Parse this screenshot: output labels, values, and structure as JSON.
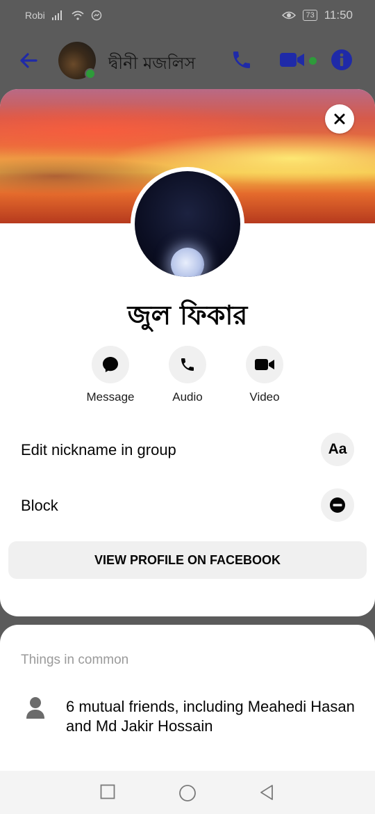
{
  "status_bar": {
    "carrier": "Robi",
    "battery": "73",
    "time": "11:50"
  },
  "header": {
    "title": "দ্বীনী মজলিস"
  },
  "profile": {
    "name": "জুল ফিকার"
  },
  "actions": [
    {
      "label": "Message",
      "icon": "message-bubble-icon"
    },
    {
      "label": "Audio",
      "icon": "phone-icon"
    },
    {
      "label": "Video",
      "icon": "video-camera-icon"
    }
  ],
  "options": {
    "edit_nickname": {
      "label": "Edit nickname in group",
      "icon_text": "Aa"
    },
    "block": {
      "label": "Block"
    }
  },
  "view_profile_label": "VIEW PROFILE ON FACEBOOK",
  "common": {
    "title": "Things in common",
    "mutual_friends": "6 mutual friends, including Meahedi Hasan and Md Jakir Hossain"
  },
  "colors": {
    "accent": "#1f2aa8",
    "online": "#2e9b3a",
    "button_bg": "#f0f0f0"
  }
}
